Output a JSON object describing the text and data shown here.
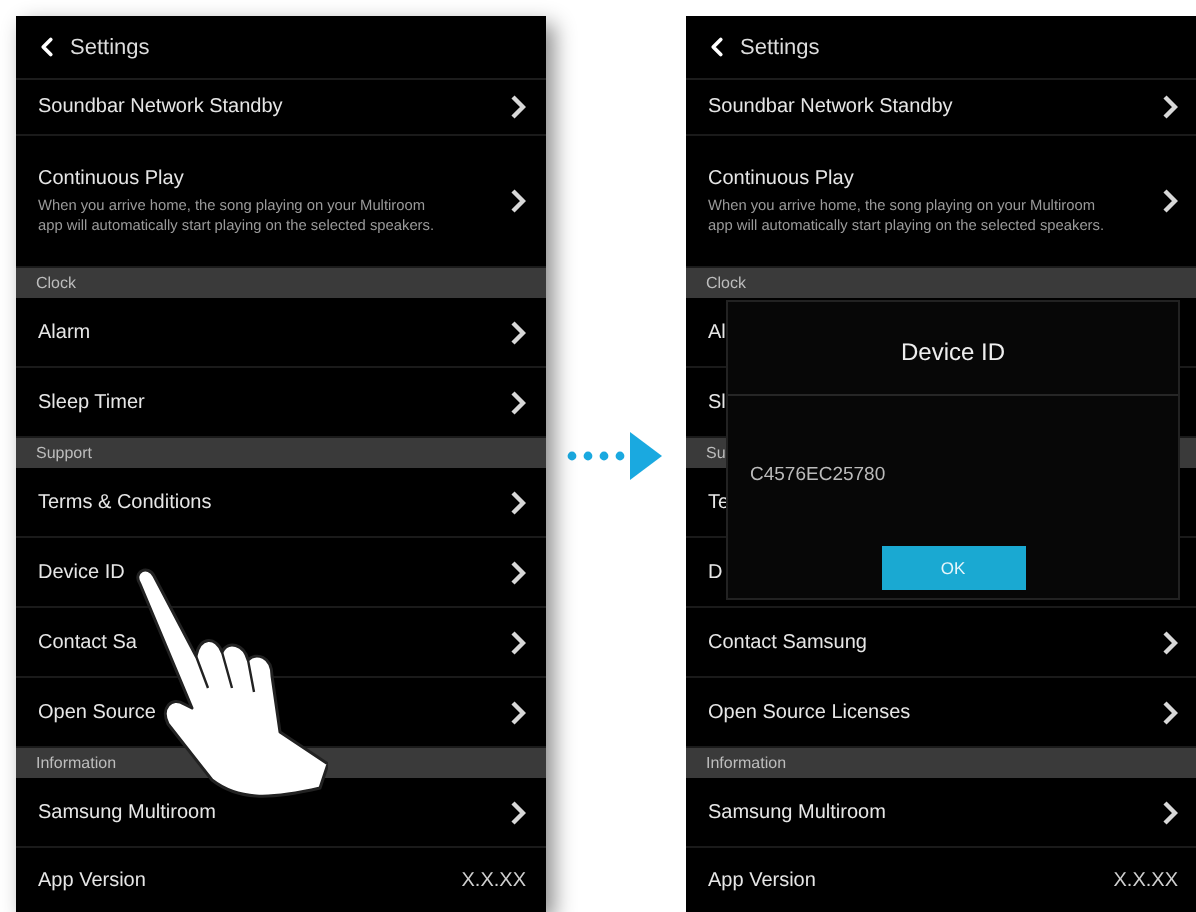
{
  "screens": [
    {
      "header": {
        "title": "Settings"
      },
      "rows": [
        {
          "kind": "item",
          "label": "Soundbar Network Standby"
        },
        {
          "kind": "detail",
          "label": "Continuous Play",
          "description": "When you arrive home, the song playing on your Multiroom app will automatically start playing on the selected speakers."
        },
        {
          "kind": "section",
          "label": "Clock"
        },
        {
          "kind": "item",
          "label": "Alarm"
        },
        {
          "kind": "item",
          "label": "Sleep Timer"
        },
        {
          "kind": "section",
          "label": "Support"
        },
        {
          "kind": "item",
          "label": "Terms & Conditions"
        },
        {
          "kind": "item",
          "label": "Device ID"
        },
        {
          "kind": "item",
          "label": "Contact Sa"
        },
        {
          "kind": "item",
          "label": "Open Source"
        },
        {
          "kind": "section",
          "label": "Information"
        },
        {
          "kind": "item",
          "label": "Samsung Multiroom"
        },
        {
          "kind": "value",
          "label": "App Version",
          "value": "X.X.XX"
        }
      ],
      "overlay": {
        "kind": "hand"
      }
    },
    {
      "header": {
        "title": "Settings"
      },
      "rows": [
        {
          "kind": "item",
          "label": "Soundbar Network Standby"
        },
        {
          "kind": "detail",
          "label": "Continuous Play",
          "description": "When you arrive home, the song playing on your Multiroom app will automatically start playing on the selected speakers."
        },
        {
          "kind": "section",
          "label": "Clock"
        },
        {
          "kind": "item",
          "label": "Al"
        },
        {
          "kind": "item",
          "label": "Sl"
        },
        {
          "kind": "section",
          "label": "Su"
        },
        {
          "kind": "item",
          "label": "Te"
        },
        {
          "kind": "item",
          "label": "D"
        },
        {
          "kind": "item",
          "label": "Contact Samsung"
        },
        {
          "kind": "item",
          "label": "Open Source Licenses"
        },
        {
          "kind": "section",
          "label": "Information"
        },
        {
          "kind": "item",
          "label": "Samsung Multiroom"
        },
        {
          "kind": "value",
          "label": "App Version",
          "value": "X.X.XX"
        }
      ],
      "overlay": {
        "kind": "dialog",
        "title": "Device ID",
        "value": "C4576EC25780",
        "button": "OK"
      }
    }
  ]
}
